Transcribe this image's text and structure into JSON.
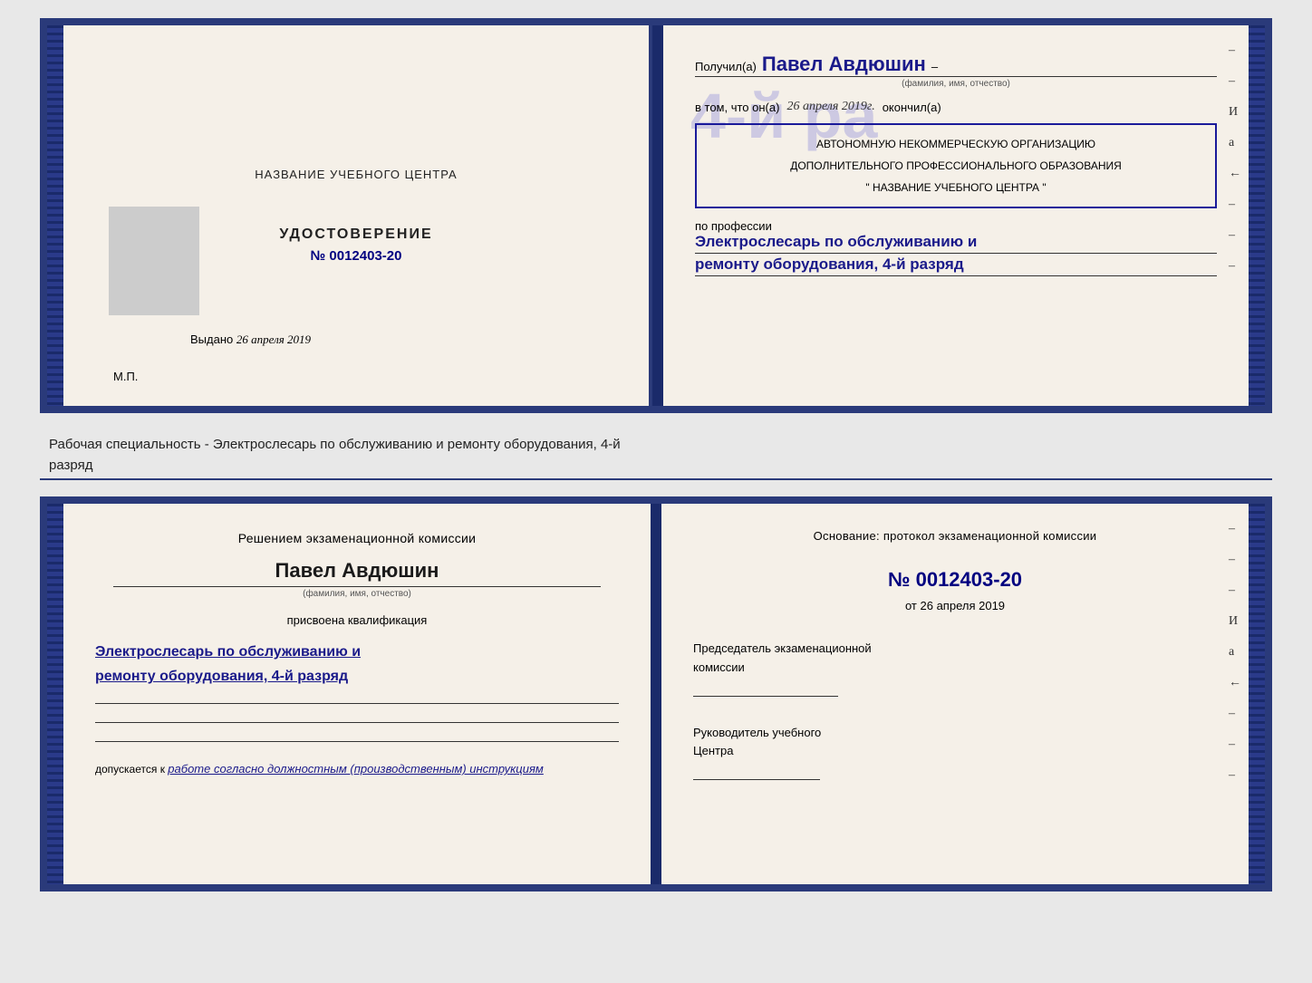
{
  "top_doc": {
    "left": {
      "title": "НАЗВАНИЕ УЧЕБНОГО ЦЕНТРА",
      "cert_label": "УДОСТОВЕРЕНИЕ",
      "cert_number_prefix": "№",
      "cert_number": "0012403-20",
      "issued_label": "Выдано",
      "issued_date": "26 апреля 2019",
      "mp_label": "М.П."
    },
    "right": {
      "received_label": "Получил(а)",
      "recipient_name": "Павел Авдюшин",
      "name_hint": "(фамилия, имя, отчество)",
      "in_that_label": "в том, что он(а)",
      "completed_date": "26 апреля 2019г.",
      "completed_label": "окончил(а)",
      "grade_big": "4-й ра",
      "org_line1": "АВТОНОМНУЮ НЕКОММЕРЧЕСКУЮ ОРГАНИЗАЦИЮ",
      "org_line2": "ДОПОЛНИТЕЛЬНОГО ПРОФЕССИОНАЛЬНОГО ОБРАЗОВАНИЯ",
      "org_name": "\" НАЗВАНИЕ УЧЕБНОГО ЦЕНТРА \"",
      "profession_label": "по профессии",
      "profession_line1": "Электрослесарь по обслуживанию и",
      "profession_line2": "ремонту оборудования, 4-й разряд"
    }
  },
  "specialty_text": "Рабочая специальность - Электрослесарь по обслуживанию и ремонту оборудования, 4-й",
  "specialty_text2": "разряд",
  "bottom_doc": {
    "left": {
      "commission_line1": "Решением экзаменационной  комиссии",
      "person_name": "Павел Авдюшин",
      "name_hint": "(фамилия, имя, отчество)",
      "assigned_label": "присвоена квалификация",
      "qual_line1": "Электрослесарь по обслуживанию и",
      "qual_line2": "ремонту оборудования, 4-й разряд",
      "admission_label": "допускается к",
      "admission_text": "работе согласно должностным (производственным) инструкциям"
    },
    "right": {
      "basis_label": "Основание: протокол экзаменационной  комиссии",
      "protocol_prefix": "№",
      "protocol_number": "0012403-20",
      "date_prefix": "от",
      "protocol_date": "26 апреля 2019",
      "chairman_line1": "Председатель экзаменационной",
      "chairman_line2": "комиссии",
      "director_line1": "Руководитель учебного",
      "director_line2": "Центра"
    }
  },
  "side_chars": {
    "chars": [
      "И",
      "а",
      "←",
      "–",
      "–",
      "–",
      "–",
      "–"
    ]
  }
}
